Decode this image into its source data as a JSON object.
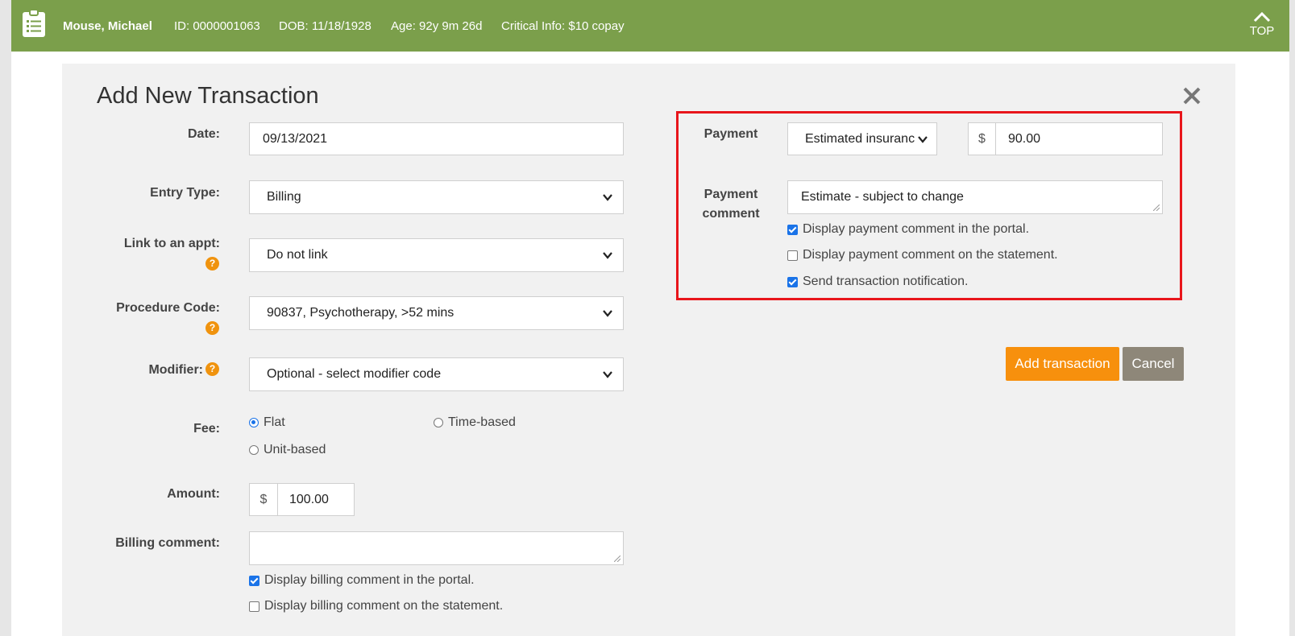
{
  "patient_bar": {
    "name": "Mouse, Michael",
    "id": "ID: 0000001063",
    "dob": "DOB: 11/18/1928",
    "age": "Age: 92y 9m 26d",
    "critical_info": "Critical Info: $10 copay",
    "top_label": "TOP",
    "bg_color": "#7b9f4b"
  },
  "modal": {
    "title": "Add New Transaction",
    "close_icon": "close-x-icon"
  },
  "form": {
    "date": {
      "label": "Date:",
      "value": "09/13/2021"
    },
    "entry_type": {
      "label": "Entry Type:",
      "value": "Billing"
    },
    "link_appt": {
      "label": "Link to an appt:",
      "value": "Do not link"
    },
    "procedure_code": {
      "label": "Procedure Code:",
      "value": "90837, Psychotherapy, >52 mins"
    },
    "modifier": {
      "label": "Modifier:",
      "value": "Optional - select modifier code"
    },
    "fee": {
      "label": "Fee:",
      "options": [
        {
          "label": "Flat",
          "selected": true
        },
        {
          "label": "Time-based",
          "selected": false
        },
        {
          "label": "Unit-based",
          "selected": false
        }
      ]
    },
    "amount": {
      "label": "Amount:",
      "currency": "$",
      "value": "100.00"
    },
    "billing_comment": {
      "label": "Billing comment:",
      "value": "",
      "checkboxes": [
        {
          "label": "Display billing comment in the portal.",
          "checked": true
        },
        {
          "label": "Display billing comment on the statement.",
          "checked": false
        }
      ]
    }
  },
  "payment": {
    "label": "Payment",
    "method": "Estimated insurance",
    "currency": "$",
    "amount": "90.00",
    "comment_label_line1": "Payment",
    "comment_label_line2": "comment",
    "comment_value": "Estimate - subject to change",
    "checkboxes": [
      {
        "label": "Display payment comment in the portal.",
        "checked": true
      },
      {
        "label": "Display payment comment on the statement.",
        "checked": false
      },
      {
        "label": "Send transaction notification.",
        "checked": true
      }
    ],
    "highlight_color": "#e8151b"
  },
  "actions": {
    "add_label": "Add transaction",
    "cancel_label": "Cancel",
    "add_color": "#f7900d",
    "cancel_color": "#8e8779"
  },
  "help_icon": "?"
}
